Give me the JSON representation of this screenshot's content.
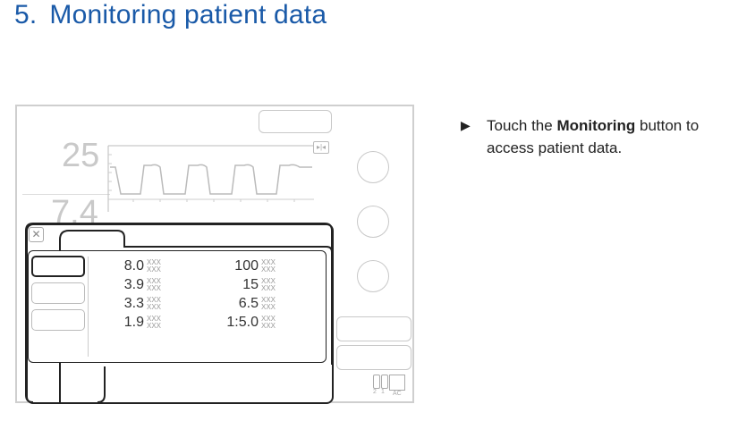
{
  "heading": {
    "number": "5.",
    "title": "Monitoring patient data"
  },
  "instruction": {
    "arrow": "▶",
    "before": "Touch the ",
    "bold": "Monitoring",
    "after": " button to access patient data."
  },
  "screen": {
    "big_values": [
      "25",
      "7.4"
    ],
    "left_column": [
      {
        "value": "8.0",
        "unit": "XXX"
      },
      {
        "value": "3.9",
        "unit": "XXX"
      },
      {
        "value": "3.3",
        "unit": "XXX"
      },
      {
        "value": "1.9",
        "unit": "XXX"
      }
    ],
    "right_column": [
      {
        "value": "100",
        "unit": "XXX"
      },
      {
        "value": "15",
        "unit": "XXX"
      },
      {
        "value": "6.5",
        "unit": "XXX"
      },
      {
        "value": "1:5.0",
        "unit": "XXX"
      }
    ],
    "close_icon": "✕",
    "status_icons": [
      "battery-icon",
      "battery-icon",
      "plug-icon"
    ],
    "status_labels": [
      "2",
      "1",
      "AC"
    ]
  }
}
